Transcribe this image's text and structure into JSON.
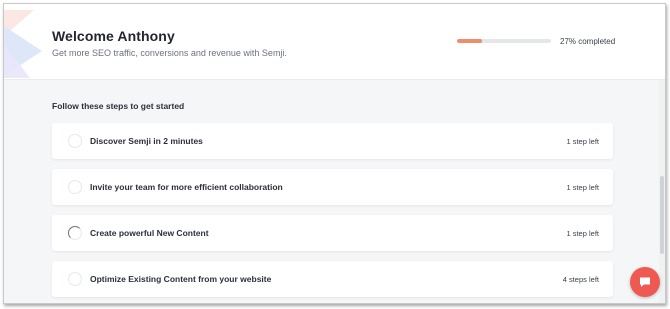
{
  "header": {
    "title": "Welcome Anthony",
    "subtitle": "Get more SEO traffic, conversions and revenue with Semji.",
    "progress_percent": 27,
    "progress_label": "27% completed"
  },
  "onboarding": {
    "section_title": "Follow these steps to get started",
    "steps": [
      {
        "label": "Discover Semji in 2 minutes",
        "meta": "1 step left",
        "state": "not-started"
      },
      {
        "label": "Invite your team for more efficient collaboration",
        "meta": "1 step left",
        "state": "not-started"
      },
      {
        "label": "Create powerful New Content",
        "meta": "1 step left",
        "state": "in-progress"
      },
      {
        "label": "Optimize Existing Content from your website",
        "meta": "4 steps left",
        "state": "not-started"
      }
    ]
  },
  "colors": {
    "accent": "#ef8c6a",
    "chat_button": "#ee5a52"
  },
  "icons": {
    "chat": "chat-bubble-icon"
  }
}
